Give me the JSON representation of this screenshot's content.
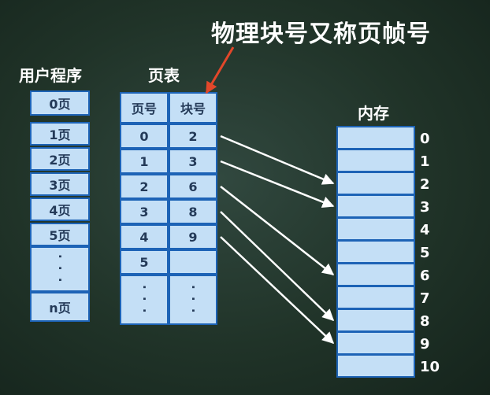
{
  "title": "物理块号又称页帧号",
  "labels": {
    "user_program": "用户程序",
    "page_table": "页表",
    "memory": "内存"
  },
  "user_program": {
    "pages": [
      "0页",
      "1页",
      "2页",
      "3页",
      "4页",
      "5页"
    ],
    "ellipsis": "· · ·",
    "last_page": "n页"
  },
  "page_table": {
    "headers": [
      "页号",
      "块号"
    ],
    "rows": [
      {
        "page": "0",
        "block": "2"
      },
      {
        "page": "1",
        "block": "3"
      },
      {
        "page": "2",
        "block": "6"
      },
      {
        "page": "3",
        "block": "8"
      },
      {
        "page": "4",
        "block": "9"
      },
      {
        "page": "5",
        "block": ""
      }
    ],
    "ellipsis": "· · ·"
  },
  "memory": {
    "indices": [
      "0",
      "1",
      "2",
      "3",
      "4",
      "5",
      "6",
      "7",
      "8",
      "9",
      "10"
    ]
  },
  "colors": {
    "cell_fill": "#c4dff6",
    "cell_border": "#1d63b6",
    "annotation_arrow": "#e2472a",
    "mapping_arrow": "#ffffff"
  }
}
